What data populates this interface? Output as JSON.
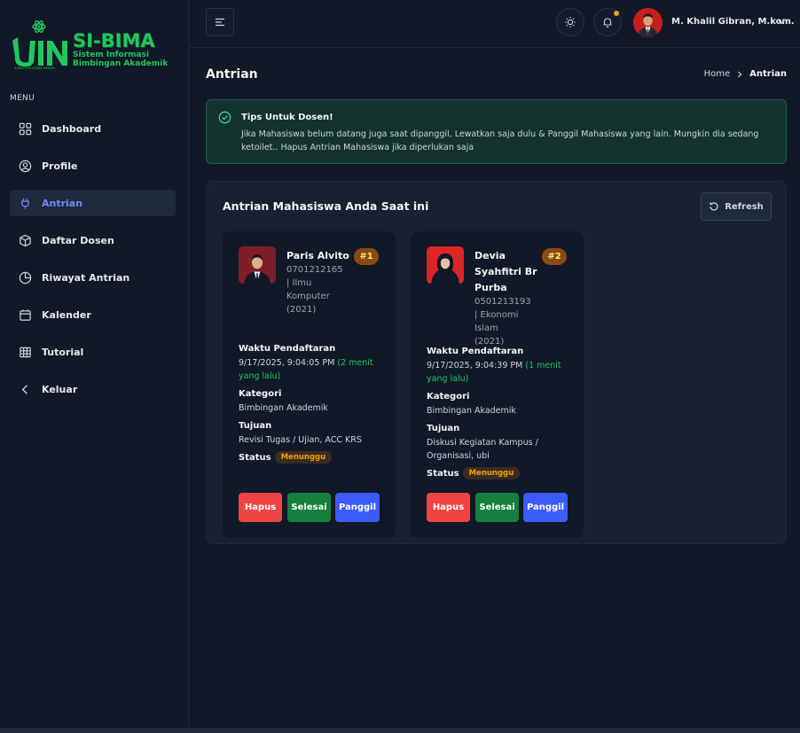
{
  "brand": {
    "title": "SI-BIMA",
    "subtitle_line1": "Sistem Informasi",
    "subtitle_line2": "Bimbingan Akademik",
    "mark_text": "UIN",
    "mark_caption": "SUMATERA UTARA MEDAN"
  },
  "sidebar": {
    "menu_label": "MENU",
    "items": [
      {
        "label": "Dashboard",
        "icon": "dashboard-icon"
      },
      {
        "label": "Profile",
        "icon": "user-circle-icon"
      },
      {
        "label": "Antrian",
        "icon": "plug-icon",
        "active": true
      },
      {
        "label": "Daftar Dosen",
        "icon": "cube-icon"
      },
      {
        "label": "Riwayat Antrian",
        "icon": "pie-chart-icon"
      },
      {
        "label": "Kalender",
        "icon": "calendar-icon"
      },
      {
        "label": "Tutorial",
        "icon": "table-icon"
      },
      {
        "label": "Keluar",
        "icon": "chevron-left-icon"
      }
    ]
  },
  "header": {
    "user_name": "M. Khalil Gibran, M.kom."
  },
  "page": {
    "title": "Antrian",
    "breadcrumb": {
      "home": "Home",
      "current": "Antrian"
    }
  },
  "alert": {
    "title": "Tips Untuk Dosen!",
    "text": "Jika Mahasiswa belum datang juga saat dipanggil, Lewatkan saja dulu & Panggil Mahasiswa yang lain. Mungkin dia sedang ketoilet.. Hapus Antrian Mahasiswa jika diperlukan saja"
  },
  "queue": {
    "title": "Antrian Mahasiswa Anda Saat ini",
    "refresh_label": "Refresh",
    "labels": {
      "waktu": "Waktu Pendaftaran",
      "kategori": "Kategori",
      "tujuan": "Tujuan",
      "status": "Status"
    },
    "buttons": {
      "hapus": "Hapus",
      "selesai": "Selesai",
      "panggil": "Panggil"
    },
    "cards": [
      {
        "name": "Paris Alvito",
        "rank": "#1",
        "nim_prodi": "0701212165 | Ilmu Komputer (2021)",
        "waktu": "9/17/2025, 9:04:05 PM",
        "ago": "(2 menit yang lalu)",
        "kategori": "Bimbingan Akademik",
        "tujuan": "Revisi Tugas / Ujian, ACC KRS",
        "status": "Menunggu",
        "photo_bg": "#7f1d2a"
      },
      {
        "name": "Devia Syahfitri Br Purba",
        "rank": "#2",
        "nim_prodi": "0501213193 | Ekonomi Islam (2021)",
        "waktu": "9/17/2025, 9:04:39 PM",
        "ago": "(1 menit yang lalu)",
        "kategori": "Bimbingan Akademik",
        "tujuan": "Diskusi Kegiatan Kampus / Organisasi, ubi",
        "status": "Menunggu",
        "photo_bg": "#dc2626"
      }
    ]
  }
}
